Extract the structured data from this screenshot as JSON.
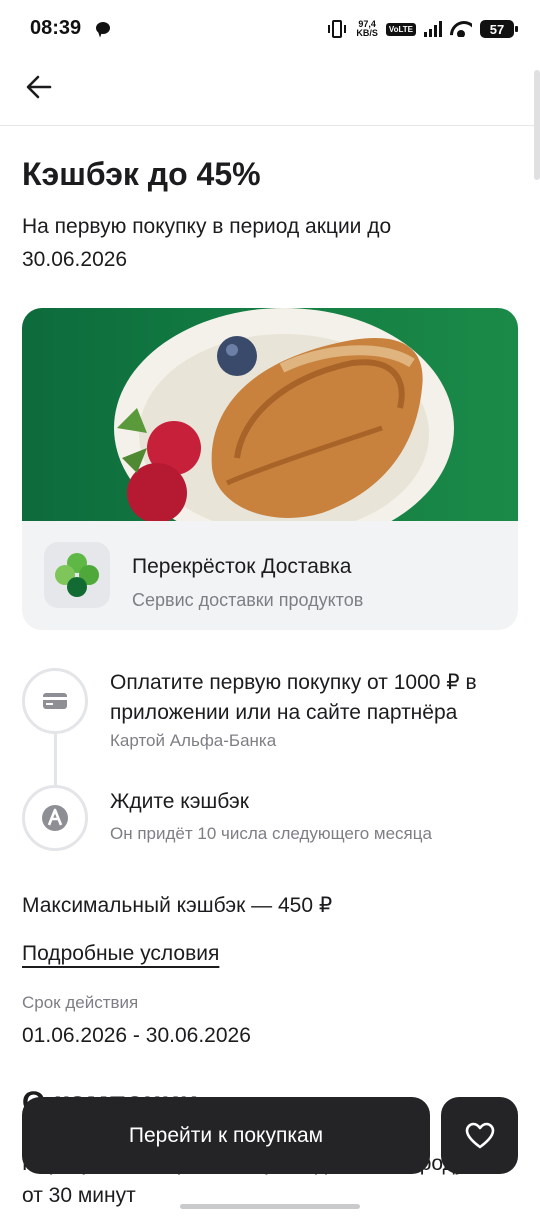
{
  "status_bar": {
    "time": "08:39",
    "net_speed_value": "97,4",
    "net_speed_unit": "KB/S",
    "volte": "VoLTE",
    "battery": "57"
  },
  "header": {
    "back_icon": "arrow-left-icon"
  },
  "offer": {
    "title": "Кэшбэк до 45%",
    "subtitle": "На первую покупку в период акции до 30.06.2026"
  },
  "partner": {
    "name": "Перекрёсток Доставка",
    "description": "Сервис доставки продуктов",
    "logo_icon": "clover-logo-icon",
    "banner_color": "#137e43"
  },
  "steps": [
    {
      "title": "Оплатите первую покупку от 1000 ₽ в приложении или на сайте партнёра",
      "note": "Картой Альфа-Банка",
      "icon": "card-icon"
    },
    {
      "title": "Ждите кэшбэк",
      "note": "Он придёт 10 числа следующего месяца",
      "icon": "alfa-a-icon"
    }
  ],
  "details": {
    "max_cashback": "Максимальный кэшбэк — 450 ₽",
    "terms_link": "Подробные условия",
    "validity_label": "Срок действия",
    "validity_value": "01.06.2026 - 30.06.2026"
  },
  "about": {
    "title": "О компании",
    "text": "Перекрёсток Впрок — сервис доставки продуктов от 30 минут"
  },
  "actions": {
    "cta_label": "Перейти к покупкам",
    "favorite_icon": "heart-icon"
  }
}
